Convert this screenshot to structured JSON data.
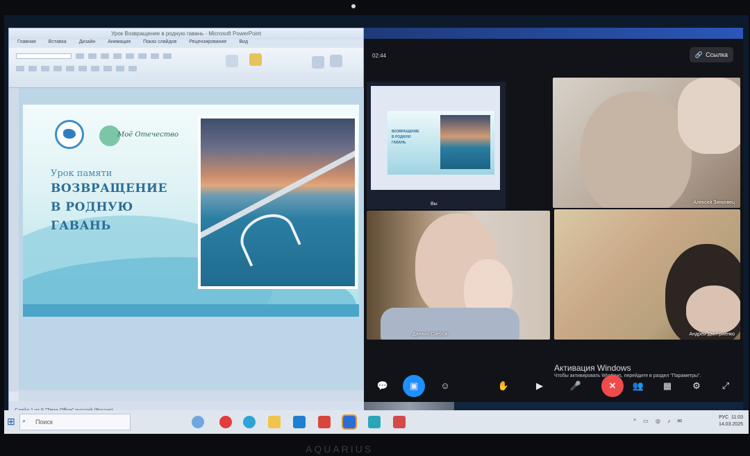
{
  "powerpoint": {
    "window_title": "Урок Возвращение в родную гавань - Microsoft PowerPoint",
    "tabs": [
      "Главная",
      "Вставка",
      "Дизайн",
      "Анимация",
      "Показ слайдов",
      "Рецензирование",
      "Вид"
    ],
    "status_text": "Слайд 1 из 9   \"Тема Office\"   русский (Россия)",
    "slide": {
      "pretitle": "Урок памяти",
      "title_lines": [
        "ВОЗВРАЩЕНИЕ",
        "В РОДНУЮ",
        "ГАВАНЬ"
      ],
      "logo_text": "Моё Отечество"
    }
  },
  "meeting": {
    "time": "02:44",
    "link_button": "Ссылка",
    "tiles": [
      {
        "name": "Вы"
      },
      {
        "name": "Алексей Зинковец"
      },
      {
        "name": "Даниил Озеров"
      },
      {
        "name": "Андрей Дмитриенко"
      }
    ],
    "share_thumb_title_lines": [
      "ВОЗВРАЩЕНИЕ",
      "В РОДНУЮ",
      "ГАВАНЬ"
    ],
    "activation": {
      "title": "Активация Windows",
      "subtitle": "Чтобы активировать Windows, перейдите в раздел \"Параметры\"."
    },
    "controls": [
      "chat-icon",
      "screen-share-icon",
      "reactions-icon",
      "raise-hand-icon",
      "camera-icon",
      "microphone-icon",
      "end-call-icon",
      "participants-icon",
      "layout-icon",
      "settings-icon",
      "fullscreen-icon"
    ]
  },
  "taskbar": {
    "search_placeholder": "Поиск",
    "lang": "РУС",
    "time": "11:03",
    "date": "14.03.2025"
  },
  "monitor_brand": "AQUARIUS"
}
